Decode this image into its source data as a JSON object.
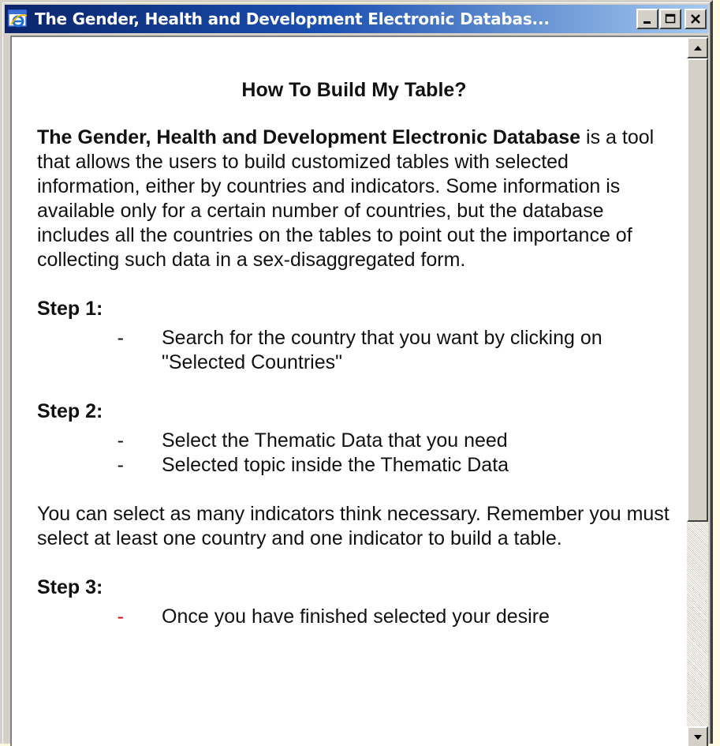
{
  "window": {
    "title": "The Gender, Health and Development Electronic Databas...",
    "icon": "internet-explorer-icon"
  },
  "title_buttons": {
    "minimize_icon": "minimize-icon",
    "maximize_icon": "maximize-icon",
    "close_icon": "close-icon"
  },
  "content": {
    "heading": "How To Build My Table?",
    "intro_bold": "The Gender, Health and Development Electronic Database",
    "intro_rest": " is a tool that allows the users to build customized tables with selected information, either by countries and indicators. Some information is available only for a certain number of countries, but the database includes all the countries on the tables to point out the importance of collecting such data in a sex-disaggregated form.",
    "step1": {
      "title": "Step 1:",
      "items": [
        {
          "bullet": "-",
          "text": "Search for the country that you want by clicking on \"Selected Countries\""
        }
      ]
    },
    "step2": {
      "title": "Step 2:",
      "items": [
        {
          "bullet": "-",
          "text": "Select the Thematic Data that you need"
        },
        {
          "bullet": "-",
          "text": "Selected topic inside the Thematic Data"
        }
      ]
    },
    "note": "You can select as many indicators think necessary. Remember you must select at least one country and one indicator to build a table.",
    "step3": {
      "title": "Step 3:",
      "items": [
        {
          "bullet": "-",
          "text": "Once you have finished selected your desire"
        }
      ]
    }
  },
  "scrollbar": {
    "up_icon": "scroll-up-arrow-icon",
    "down_icon": "scroll-down-arrow-icon"
  },
  "colors": {
    "titlebar_start": "#0a246a",
    "titlebar_end": "#a6caf0",
    "step3_bullet": "#d40000"
  }
}
